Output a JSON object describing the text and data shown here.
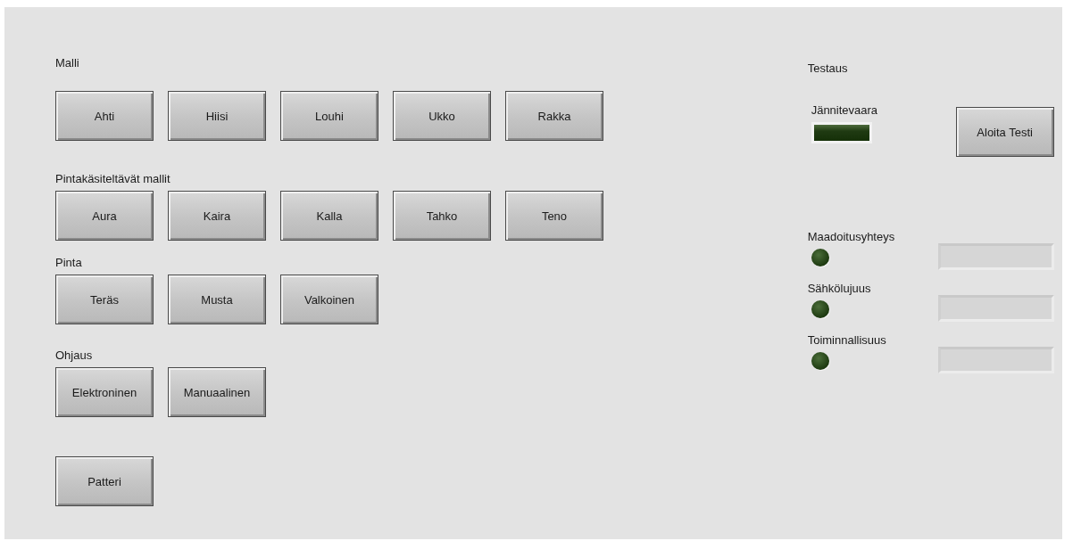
{
  "groups": [
    {
      "label": "Malli",
      "buttons": [
        "Ahti",
        "Hiisi",
        "Louhi",
        "Ukko",
        "Rakka"
      ]
    },
    {
      "label": "Pintakäsiteltävät mallit",
      "buttons": [
        "Aura",
        "Kaira",
        "Kalla",
        "Tahko",
        "Teno"
      ]
    },
    {
      "label": "Pinta",
      "buttons": [
        "Teräs",
        "Musta",
        "Valkoinen"
      ]
    },
    {
      "label": "Ohjaus",
      "buttons": [
        "Elektroninen",
        "Manuaalinen"
      ]
    },
    {
      "buttons": [
        "Patteri"
      ]
    }
  ],
  "testing": {
    "title": "Testaus",
    "warning": {
      "label": "Jännitevaara",
      "on": false
    },
    "start_button": "Aloita Testi",
    "checks": [
      {
        "label": "Maadoitusyhteys",
        "on": false
      },
      {
        "label": "Sähkölujuus",
        "on": false
      },
      {
        "label": "Toiminnallisuus",
        "on": false
      }
    ]
  }
}
